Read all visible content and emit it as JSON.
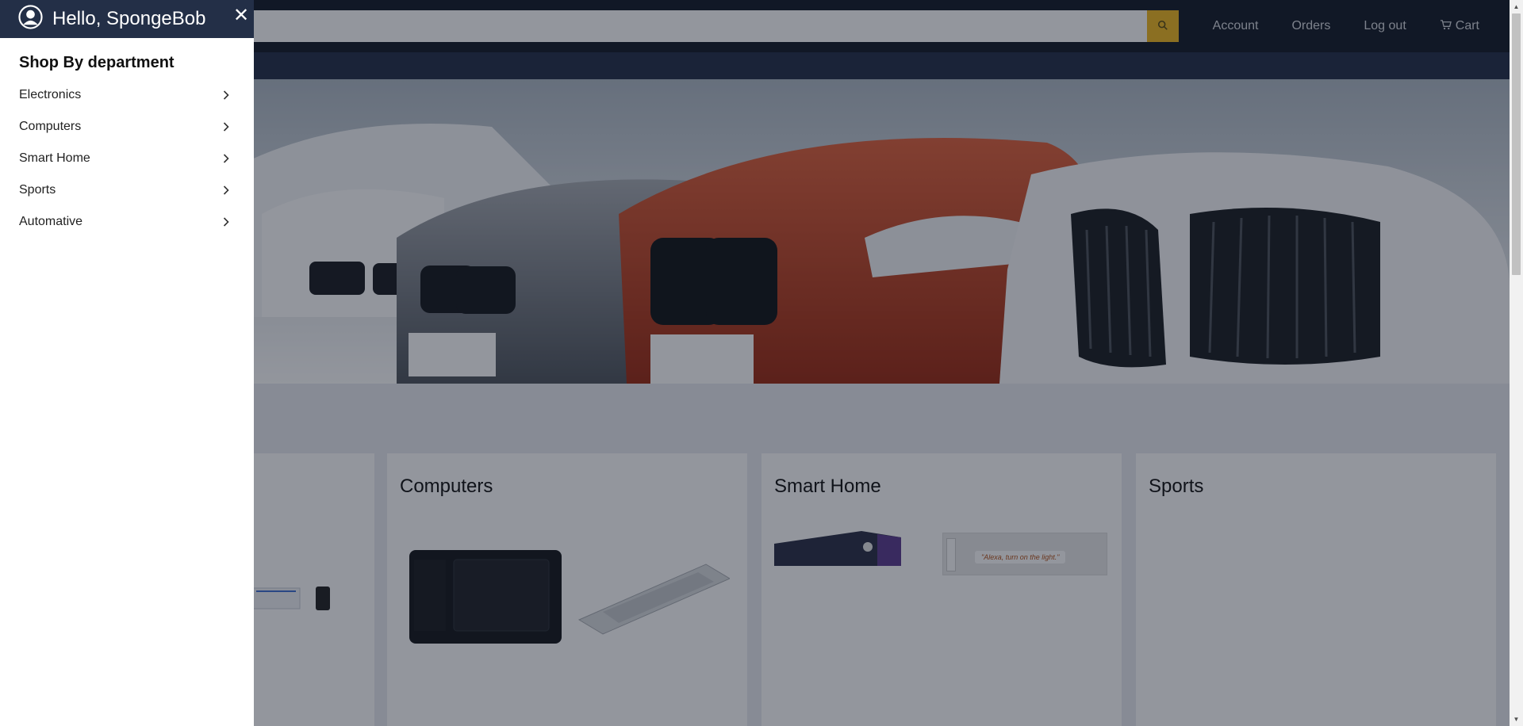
{
  "header": {
    "search_placeholder": "",
    "links": [
      "Account",
      "Orders",
      "Log out",
      "Cart"
    ]
  },
  "sidebar": {
    "greeting": "Hello, SpongeBob",
    "section_title": "Shop By department",
    "items": [
      {
        "label": "Electronics"
      },
      {
        "label": "Computers"
      },
      {
        "label": "Smart Home"
      },
      {
        "label": "Sports"
      },
      {
        "label": "Automative"
      }
    ]
  },
  "cards": [
    {
      "title": "Computers"
    },
    {
      "title": "Smart Home"
    },
    {
      "title": "Sports"
    }
  ],
  "smart_home_caption": "\"Alexa, turn on the light.\"",
  "colors": {
    "nav_dark": "#131a27",
    "nav_sub": "#232f47",
    "search_button": "#f0b81f",
    "overlay": "rgba(15,23,38,0.45)"
  },
  "icons": [
    "user-circle-icon",
    "close-icon",
    "chevron-right-icon",
    "search-icon",
    "cart-icon"
  ]
}
